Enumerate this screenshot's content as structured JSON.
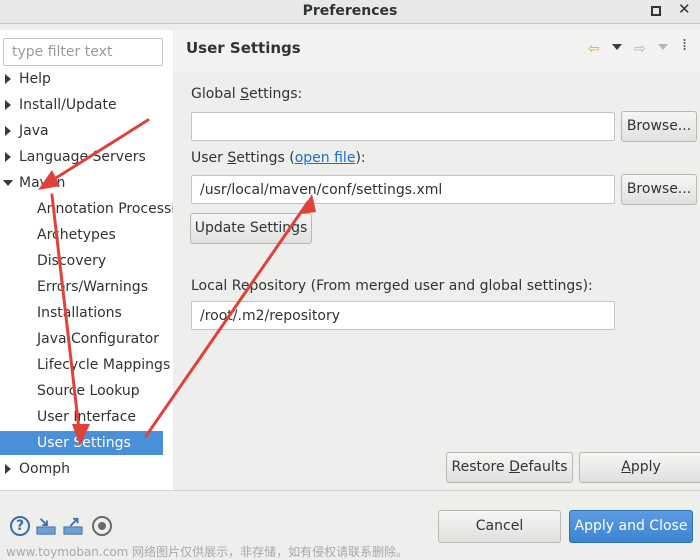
{
  "window": {
    "title": "Preferences",
    "maximize_glyph": "",
    "close_glyph": "✕"
  },
  "sidebar": {
    "filter_placeholder": "type filter text",
    "items": [
      {
        "label": "Help",
        "level": 0,
        "state": "collapsed"
      },
      {
        "label": "Install/Update",
        "level": 0,
        "state": "collapsed"
      },
      {
        "label": "Java",
        "level": 0,
        "state": "collapsed"
      },
      {
        "label": "Language Servers",
        "level": 0,
        "state": "collapsed"
      },
      {
        "label": "Maven",
        "level": 0,
        "state": "expanded"
      },
      {
        "label": "Annotation Processi",
        "level": 1
      },
      {
        "label": "Archetypes",
        "level": 1
      },
      {
        "label": "Discovery",
        "level": 1
      },
      {
        "label": "Errors/Warnings",
        "level": 1
      },
      {
        "label": "Installations",
        "level": 1
      },
      {
        "label": "Java Configurator",
        "level": 1
      },
      {
        "label": "Lifecycle Mappings",
        "level": 1
      },
      {
        "label": "Source Lookup",
        "level": 1
      },
      {
        "label": "User Interface",
        "level": 1
      },
      {
        "label": "User Settings",
        "level": 1,
        "selected": true
      },
      {
        "label": "Oomph",
        "level": 0,
        "state": "collapsed"
      }
    ]
  },
  "page": {
    "title": "User Settings",
    "nav": {
      "back_icon": "back-arrow-icon",
      "forward_icon": "forward-arrow-icon",
      "back_glyph": "⇦",
      "forward_glyph": "⇨",
      "menu_glyph": "⁞"
    },
    "global_settings": {
      "label_pre": "Global ",
      "label_mnemonic": "S",
      "label_post": "ettings:",
      "value": "",
      "browse_label": "Browse..."
    },
    "user_settings": {
      "label_pre": "User ",
      "label_mnemonic": "S",
      "label_mid": "ettings (",
      "link": "open file",
      "label_post": "):",
      "value": "/usr/local/maven/conf/settings.xml",
      "browse_label": "Browse..."
    },
    "update_settings_label": "Update Settings",
    "local_repository": {
      "label": "Local Repository (From merged user and global settings):",
      "value": "/root/.m2/repository"
    },
    "restore_defaults": {
      "pre": "Restore ",
      "mnemonic": "D",
      "post": "efaults"
    },
    "apply": {
      "mnemonic": "A",
      "post": "pply"
    }
  },
  "footer": {
    "icons": [
      "help-icon",
      "import-icon",
      "export-icon",
      "record-icon"
    ],
    "help_glyph": "?",
    "cancel_label": "Cancel",
    "apply_close_label": "Apply and Close"
  },
  "watermark": "www.toymoban.com 网络图片仅供展示，非存储，如有侵权请联系删除。",
  "colors": {
    "selection": "#4a90d9",
    "primary_button": "#3c84d2",
    "link": "#1a6fc6",
    "annotation_arrow": "#e0413b"
  }
}
